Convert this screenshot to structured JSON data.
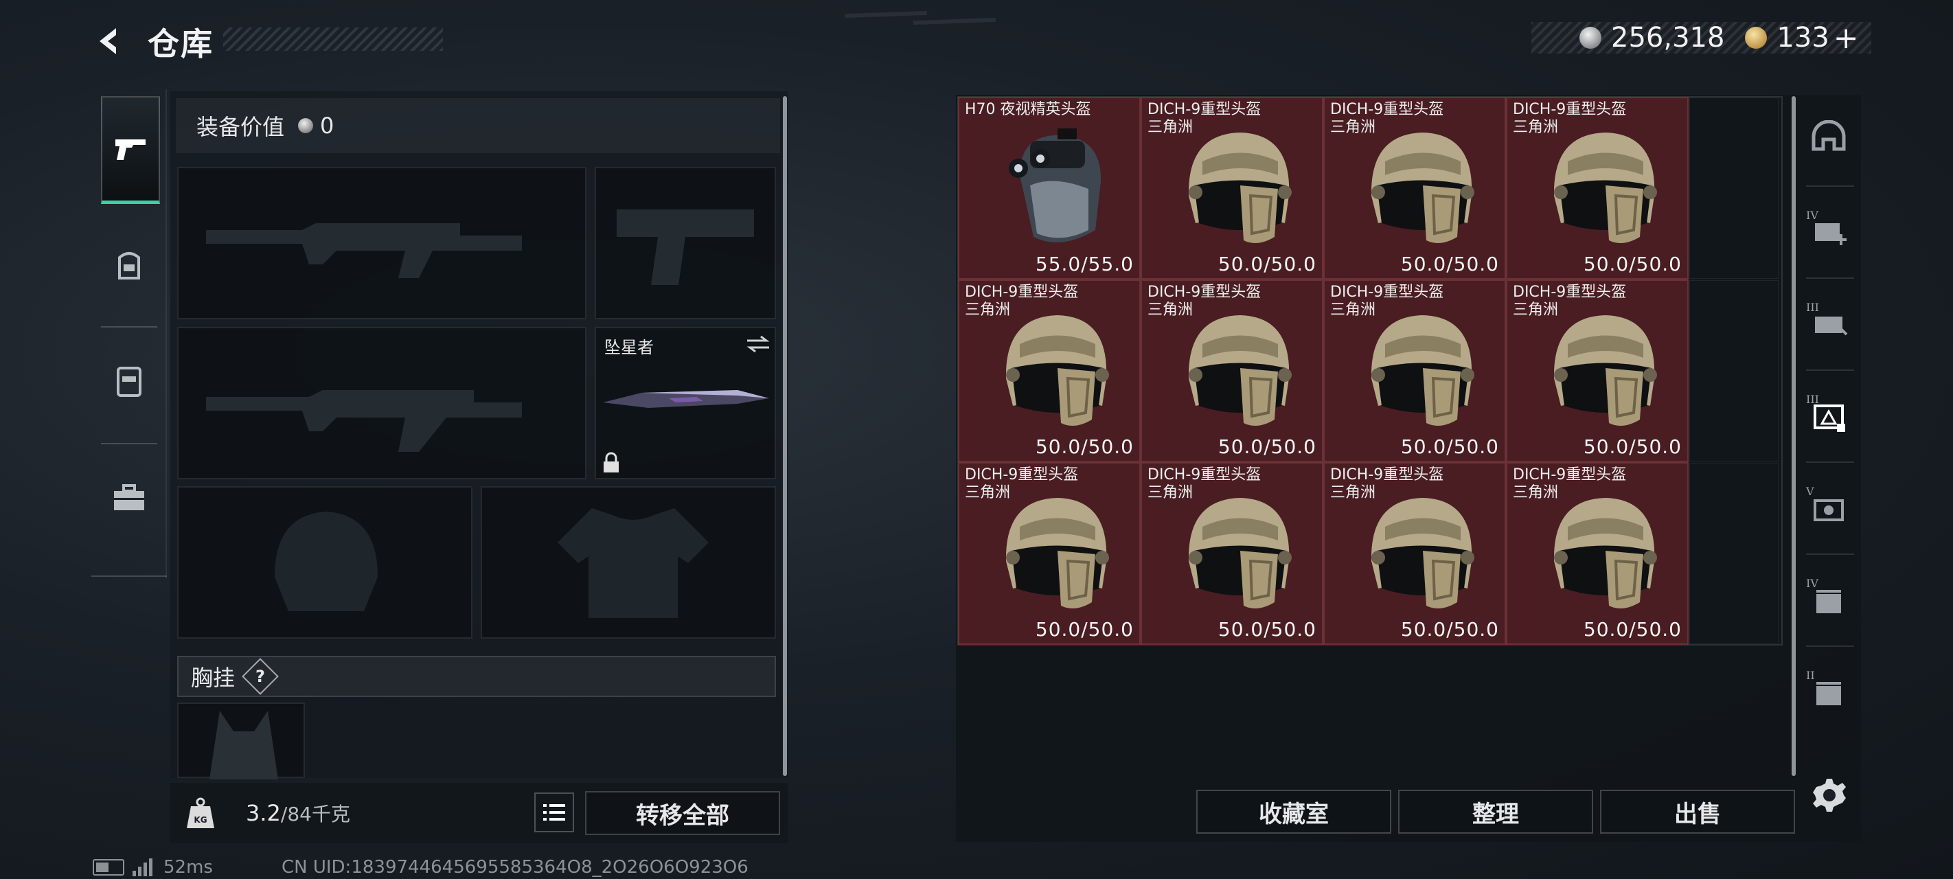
{
  "header": {
    "title": "仓库"
  },
  "currency": {
    "silver": "256,318",
    "gold": "133",
    "add": "+"
  },
  "loadout": {
    "value_label": "装备价值",
    "value": "0",
    "melee_name": "坠星者",
    "chest_label": "胸挂",
    "help": "?"
  },
  "weight": {
    "current": "3.2",
    "max": "/84千克"
  },
  "transfer_all": "转移全部",
  "stash": {
    "items": [
      {
        "name": "H70 夜视精英头盔",
        "durability": "55.0/55.0",
        "type": "nvg"
      },
      {
        "name": "DICH-9重型头盔\n三角洲",
        "durability": "50.0/50.0",
        "type": "helmet"
      },
      {
        "name": "DICH-9重型头盔\n三角洲",
        "durability": "50.0/50.0",
        "type": "helmet"
      },
      {
        "name": "DICH-9重型头盔\n三角洲",
        "durability": "50.0/50.0",
        "type": "helmet"
      },
      {
        "name": "DICH-9重型头盔\n三角洲",
        "durability": "50.0/50.0",
        "type": "helmet"
      },
      {
        "name": "DICH-9重型头盔\n三角洲",
        "durability": "50.0/50.0",
        "type": "helmet"
      },
      {
        "name": "DICH-9重型头盔\n三角洲",
        "durability": "50.0/50.0",
        "type": "helmet"
      },
      {
        "name": "DICH-9重型头盔\n三角洲",
        "durability": "50.0/50.0",
        "type": "helmet"
      },
      {
        "name": "DICH-9重型头盔\n三角洲",
        "durability": "50.0/50.0",
        "type": "helmet"
      },
      {
        "name": "DICH-9重型头盔\n三角洲",
        "durability": "50.0/50.0",
        "type": "helmet"
      },
      {
        "name": "DICH-9重型头盔\n三角洲",
        "durability": "50.0/50.0",
        "type": "helmet"
      },
      {
        "name": "DICH-9重型头盔\n三角洲",
        "durability": "50.0/50.0",
        "type": "helmet"
      }
    ],
    "buttons": {
      "collection": "收藏室",
      "organize": "整理",
      "sell": "出售"
    }
  },
  "status": {
    "ping": "52ms",
    "uid": "CN UID:1839744645695585364O8_2O26O6O923O6"
  },
  "right_tabs": [
    {
      "icon": "dome-icon",
      "label": ""
    },
    {
      "icon": "medkit-icon",
      "label": "IV"
    },
    {
      "icon": "ammo-icon",
      "label": "III"
    },
    {
      "icon": "helmet-armor-icon",
      "label": "III"
    },
    {
      "icon": "camera-icon",
      "label": "V"
    },
    {
      "icon": "container-icon",
      "label": "IV"
    },
    {
      "icon": "container-icon",
      "label": "II"
    }
  ],
  "colors": {
    "accent": "#3fd0a4",
    "item_bg": "#4a1d22"
  }
}
